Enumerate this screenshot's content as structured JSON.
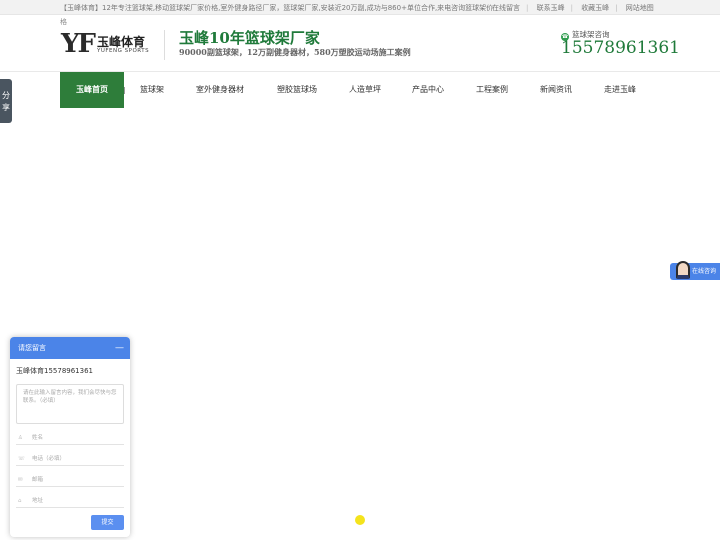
{
  "topbar": {
    "notice": "【玉峰体育】12年专注篮球架,移动篮球架厂家价格,室外健身路径厂家，篮球架厂家,安装近20万副,成功与860+单位合作,来电咨询篮球架价",
    "notice_overflow": "格",
    "links": [
      "在线留言",
      "联系玉峰",
      "收藏玉峰",
      "网站地图"
    ]
  },
  "logo": {
    "mark": "YF",
    "brand": "玉峰体育",
    "brand_en": "YUFENG SPORTS"
  },
  "header": {
    "headline": "玉峰10年篮球架厂家",
    "subline": "90000副篮球架，12万副健身器材，580万塑胶运动场施工案例",
    "hotline_label": "篮球架咨询",
    "hotline_number": "15578961361"
  },
  "nav": {
    "items": [
      "玉峰首页",
      "篮球架",
      "室外健身器材",
      "塑胶篮球场",
      "人造草坪",
      "产品中心",
      "工程案例",
      "新闻资讯",
      "走进玉峰"
    ]
  },
  "share": {
    "label": "分享"
  },
  "float_consult": {
    "label": "在线咨询"
  },
  "message_box": {
    "title": "请您留言",
    "minimize": "—",
    "company": "玉峰体育15578961361",
    "content_placeholder": "请在此输入留言内容，我们会尽快与您联系。（必填）",
    "fields": [
      {
        "icon": "user-icon",
        "glyph": "♙",
        "placeholder": "姓名"
      },
      {
        "icon": "phone-icon",
        "glyph": "☏",
        "placeholder": "电话（必填）"
      },
      {
        "icon": "email-icon",
        "glyph": "✉",
        "placeholder": "邮箱"
      },
      {
        "icon": "location-icon",
        "glyph": "⌂",
        "placeholder": "地址"
      }
    ],
    "submit": "提交"
  },
  "colors": {
    "brand_green": "#2e7d3a",
    "headline_green": "#1f7a3a",
    "chat_blue": "#4b84e8"
  }
}
